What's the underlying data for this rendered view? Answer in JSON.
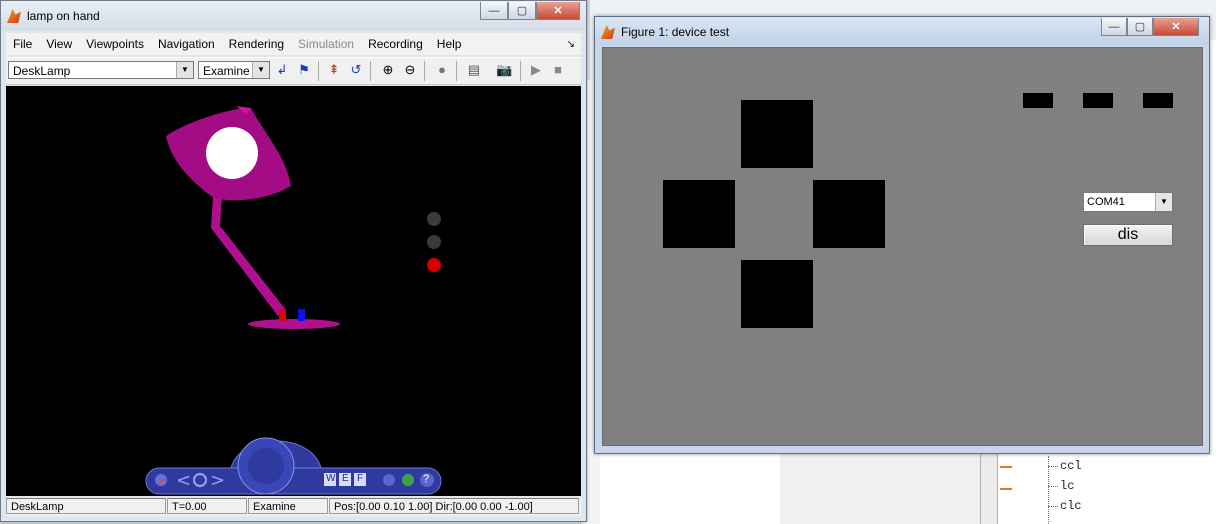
{
  "vrml_viewer": {
    "title": "lamp on hand",
    "window_buttons": {
      "minimize": "—",
      "maximize": "▢",
      "close": "✕"
    },
    "menu": [
      "File",
      "View",
      "Viewpoints",
      "Navigation",
      "Rendering",
      "Simulation",
      "Recording",
      "Help"
    ],
    "menu_disabled": [
      "Simulation"
    ],
    "toolbar": {
      "viewpoint_value": "DeskLamp",
      "nav_mode_value": "Examine"
    },
    "status": {
      "viewpoint": "DeskLamp",
      "time": "T=0.00",
      "mode": "Examine",
      "pos_dir": "Pos:[0.00 0.10 1.00] Dir:[0.00 0.00 -1.00]"
    },
    "nav_panel": {
      "wef_labels": [
        "W",
        "E",
        "F"
      ],
      "help_label": "?"
    },
    "colors": {
      "lamp": "#b0108f",
      "bulb": "#ffffff",
      "indicator_off": "#3a3a3a",
      "indicator_on": "#d40000",
      "nav_panel": "#2e3a9e"
    }
  },
  "figure": {
    "title": "Figure 1: device test",
    "window_buttons": {
      "minimize": "—",
      "maximize": "▢",
      "close": "✕"
    },
    "com_port_value": "COM41",
    "dis_button_label": "dis",
    "colors": {
      "background": "#808080",
      "squares": "#000000"
    }
  },
  "background": {
    "command_list": [
      "ccl",
      "lc",
      "clc"
    ]
  }
}
